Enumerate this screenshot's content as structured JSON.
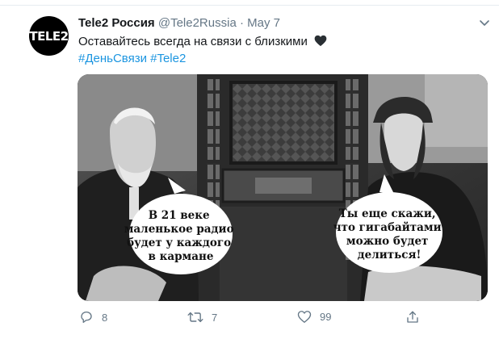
{
  "tweet": {
    "avatar_text": "TELE2",
    "display_name": "Tele2 Россия",
    "handle": "@Tele2Russia",
    "separator": "·",
    "date": "May 7",
    "text": "Оставайтесь всегда на связи с близкими",
    "emoji": "black-heart-icon",
    "hashtags": "#ДеньСвязи #Tele2"
  },
  "media": {
    "bubble_left": [
      "В 21 веке",
      "маленькое радио",
      "будет у каждого",
      "в кармане"
    ],
    "bubble_right": [
      "Ты еще скажи,",
      "что гигабайтами",
      "можно будет",
      "делиться!"
    ]
  },
  "actions": {
    "reply_count": "8",
    "retweet_count": "7",
    "like_count": "99"
  },
  "colors": {
    "link": "#1b95e0",
    "muted": "#657786",
    "text": "#14171a"
  }
}
